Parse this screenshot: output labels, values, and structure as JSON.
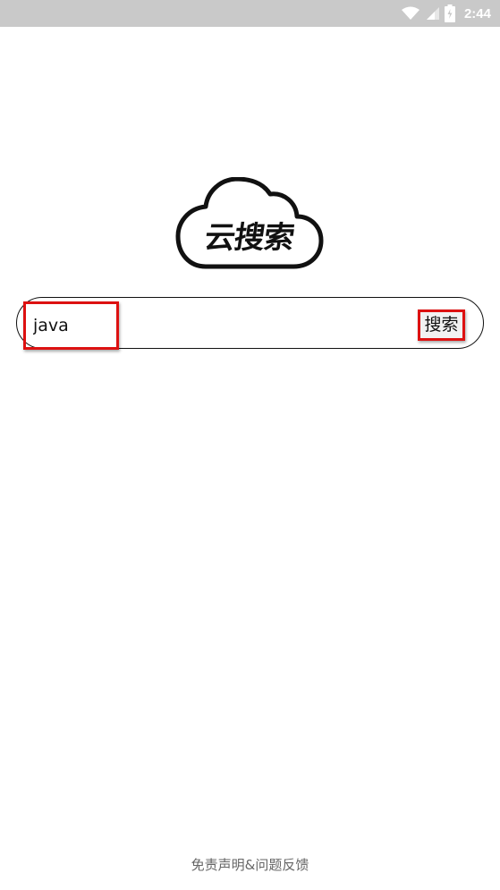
{
  "status_bar": {
    "time": "2:44",
    "icons": [
      "wifi-icon",
      "signal-icon",
      "battery-icon"
    ]
  },
  "logo": {
    "text": "云搜索"
  },
  "search": {
    "value": "java",
    "button_label": "搜索"
  },
  "footer": {
    "link_text": "免责声明&问题反馈"
  },
  "colors": {
    "status_bar_bg": "#c9c9c9",
    "highlight_border": "#dd1111",
    "text": "#111111"
  }
}
